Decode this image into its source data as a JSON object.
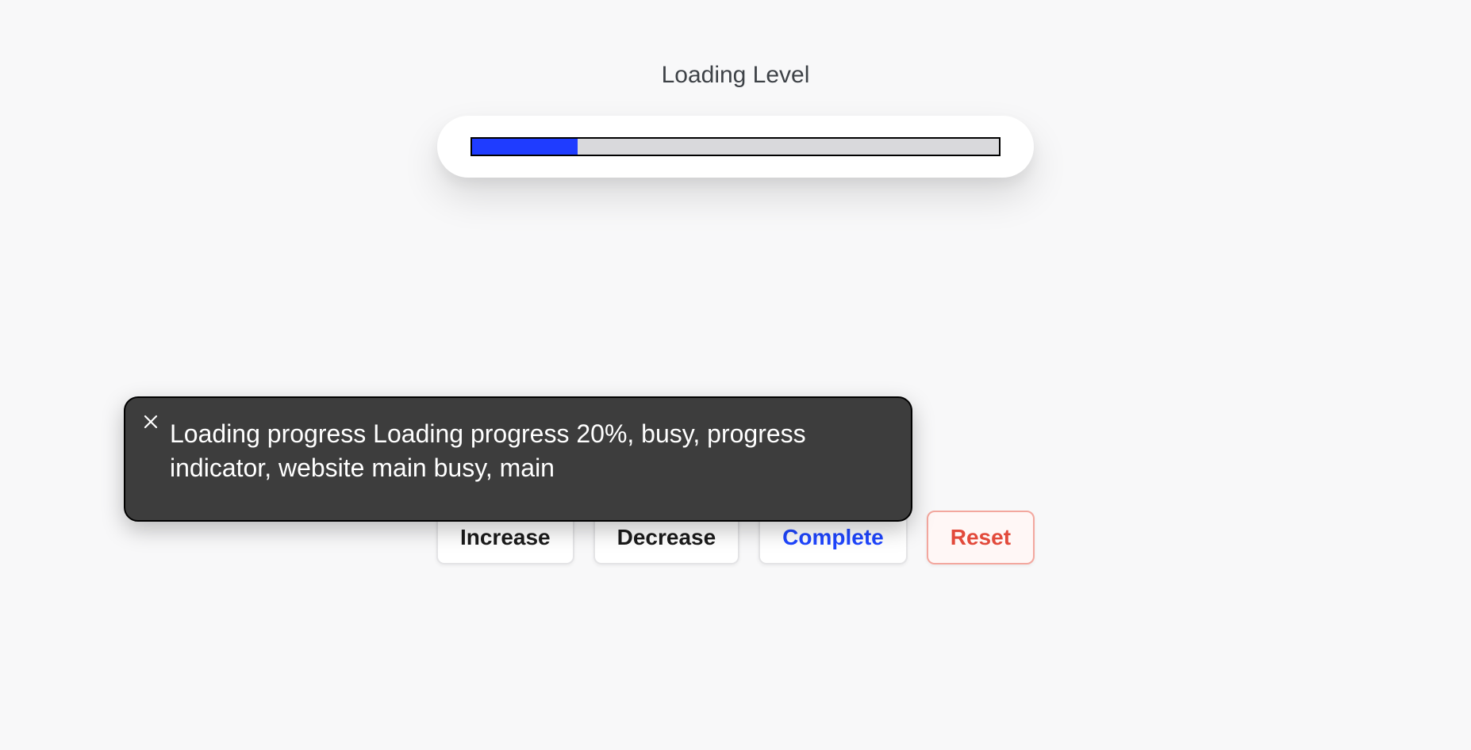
{
  "heading": "Loading Level",
  "progress": {
    "percent": 20,
    "fill_color": "#1f3cff",
    "track_color": "#d9d9dc"
  },
  "buttons": {
    "increase": "Increase",
    "decrease": "Decrease",
    "complete": "Complete",
    "reset": "Reset"
  },
  "tooltip": {
    "text": "Loading progress Loading progress 20%, busy, progress indicator, website main busy, main"
  }
}
